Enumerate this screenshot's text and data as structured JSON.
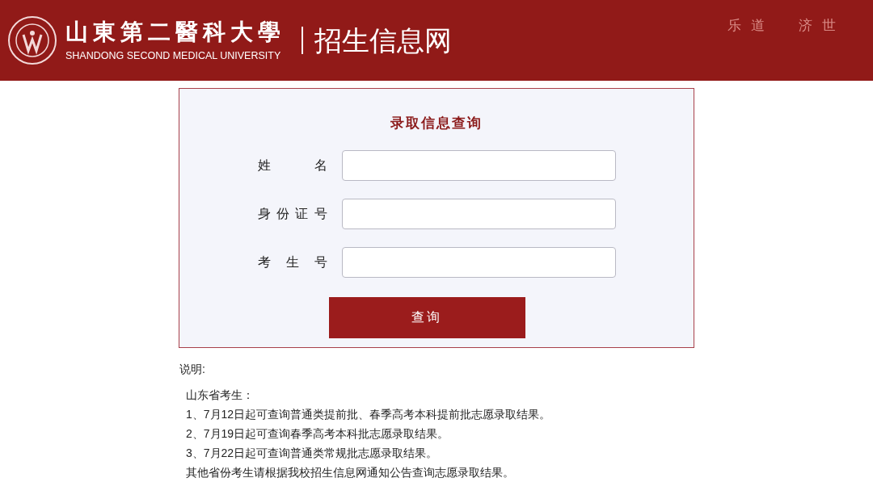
{
  "header": {
    "university_name": "山東第二醫科大學",
    "university_name_en": "SHANDONG SECOND MEDICAL UNIVERSITY",
    "site_title": "招生信息网",
    "motto": [
      "乐道",
      "济世"
    ]
  },
  "form": {
    "title": "录取信息查询",
    "fields": [
      {
        "label": "姓名"
      },
      {
        "label": "身份证号"
      },
      {
        "label": "考生号"
      }
    ],
    "submit": "查询"
  },
  "notes": {
    "heading": "说明:",
    "lines": [
      "山东省考生：",
      "1、7月12日起可查询普通类提前批、春季高考本科提前批志愿录取结果。",
      "2、7月19日起可查询春季高考本科批志愿录取结果。",
      "3、7月22日起可查询普通类常规批志愿录取结果。",
      "其他省份考生请根据我校招生信息网通知公告查询志愿录取结果。"
    ]
  }
}
